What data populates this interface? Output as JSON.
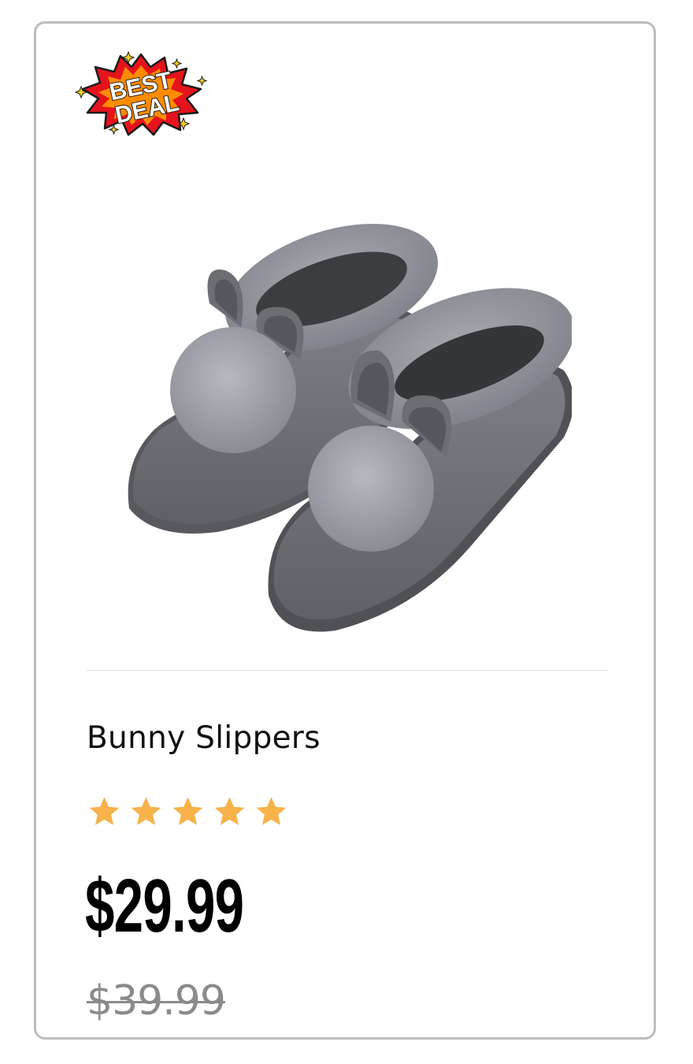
{
  "badge": {
    "text_line1": "BEST",
    "text_line2": "DEAL",
    "colors": {
      "outer": "#e5131b",
      "inner": "#ff8c00",
      "text": "#ffffff",
      "outline": "#1a1a1a"
    }
  },
  "product": {
    "name": "Bunny Slippers",
    "image_icon": "bunny-slippers-image",
    "rating": {
      "value": 5,
      "max": 5,
      "star_color": "#f7b24a"
    },
    "price": "$29.99",
    "original_price": "$39.99"
  }
}
